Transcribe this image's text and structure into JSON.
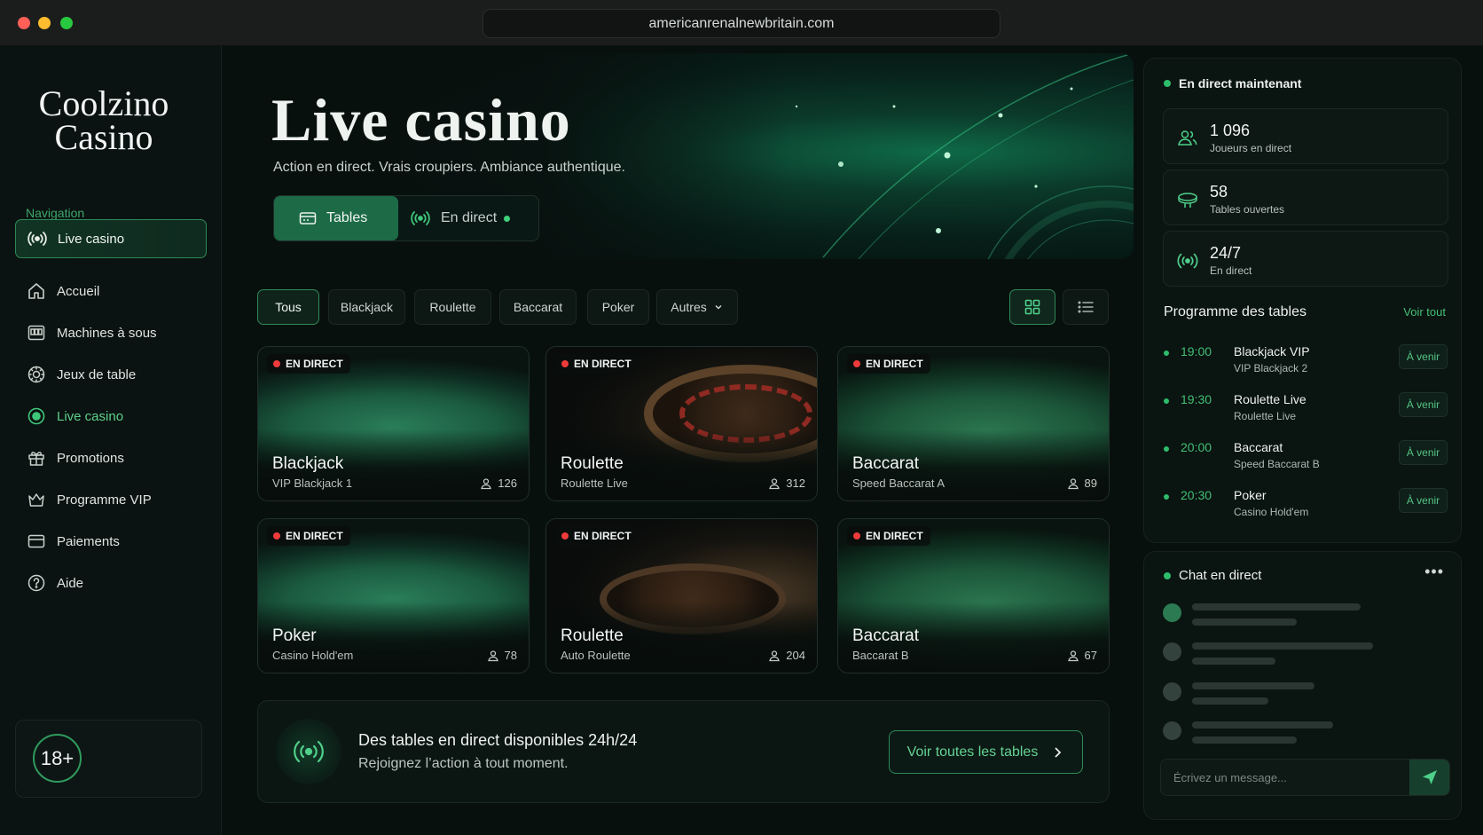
{
  "browser": {
    "url": "americanrenalnewbritain.com"
  },
  "sidebar": {
    "logo_line1": "Coolzino",
    "logo_line2": "Casino",
    "nav_heading": "Navigation",
    "items": [
      {
        "label": "Live casino",
        "icon": "live-signal-icon"
      },
      {
        "label": "Accueil",
        "icon": "home-icon"
      },
      {
        "label": "Machines à sous",
        "icon": "slot-machine-icon"
      },
      {
        "label": "Jeux de table",
        "icon": "chip-icon"
      },
      {
        "label": "Live casino",
        "icon": "live-circle-icon"
      },
      {
        "label": "Promotions",
        "icon": "gift-icon"
      },
      {
        "label": "Programme VIP",
        "icon": "crown-icon"
      },
      {
        "label": "Paiements",
        "icon": "wallet-icon"
      },
      {
        "label": "Aide",
        "icon": "help-icon"
      }
    ],
    "age_badge": "18+"
  },
  "hero": {
    "title": "Live casino",
    "subtitle": "Action en direct. Vrais croupiers. Ambiance authentique.",
    "tab_tables": "Tables",
    "tab_live": "En direct"
  },
  "filters": {
    "chips": [
      "Tous",
      "Blackjack",
      "Roulette",
      "Baccarat",
      "Poker",
      "Autres"
    ],
    "active": "Tous"
  },
  "cards": [
    {
      "badge": "EN DIRECT",
      "title": "Blackjack",
      "subtitle": "VIP Blackjack 1",
      "players": "126"
    },
    {
      "badge": "EN DIRECT",
      "title": "Roulette",
      "subtitle": "Roulette Live",
      "players": "312"
    },
    {
      "badge": "EN DIRECT",
      "title": "Baccarat",
      "subtitle": "Speed Baccarat A",
      "players": "89"
    },
    {
      "badge": "EN DIRECT",
      "title": "Poker",
      "subtitle": "Casino Hold'em",
      "players": "78"
    },
    {
      "badge": "EN DIRECT",
      "title": "Roulette",
      "subtitle": "Auto Roulette",
      "players": "204"
    },
    {
      "badge": "EN DIRECT",
      "title": "Baccarat",
      "subtitle": "Baccarat B",
      "players": "67"
    }
  ],
  "banner": {
    "title": "Des tables en direct disponibles 24h/24",
    "subtitle": "Rejoignez l’action à tout moment.",
    "button": "Voir toutes les tables"
  },
  "live_now": {
    "heading": "En direct maintenant",
    "stats": [
      {
        "value": "1 096",
        "label": "Joueurs en direct",
        "icon": "users-icon"
      },
      {
        "value": "58",
        "label": "Tables ouvertes",
        "icon": "table-icon"
      },
      {
        "value": "24/7",
        "label": "En direct",
        "icon": "live-signal-icon"
      }
    ]
  },
  "schedule": {
    "heading": "Programme des tables",
    "see_all": "Voir tout",
    "rows": [
      {
        "time": "19:00",
        "name": "Blackjack VIP",
        "sub": "VIP Blackjack 2",
        "status": "À venir"
      },
      {
        "time": "19:30",
        "name": "Roulette Live",
        "sub": "Roulette Live",
        "status": "À venir"
      },
      {
        "time": "20:00",
        "name": "Baccarat",
        "sub": "Speed Baccarat B",
        "status": "À venir"
      },
      {
        "time": "20:30",
        "name": "Poker",
        "sub": "Casino Hold'em",
        "status": "À venir"
      }
    ]
  },
  "chat": {
    "heading": "Chat en direct",
    "more": "•••",
    "placeholder": "Écrivez un message..."
  },
  "colors": {
    "accent": "#2ebd6b",
    "accent_dark": "#1d6b46",
    "live_red": "#ef3b3b",
    "background": "#08100e"
  }
}
